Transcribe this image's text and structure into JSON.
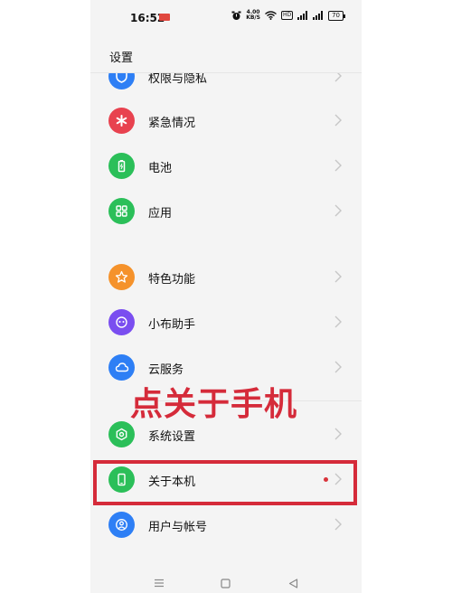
{
  "status_bar": {
    "time": "16:52",
    "notification_badge": "",
    "network_speed_top": "4.00",
    "network_speed_bottom": "KB/S",
    "hd_tag": "HD",
    "battery": "70",
    "icons": [
      "alarm-icon",
      "wifi-icon",
      "signal-icon",
      "signal-icon"
    ]
  },
  "header": {
    "title": "设置"
  },
  "settings_items": [
    {
      "label": "权限与隐私",
      "icon": "shield-icon",
      "color": "#2e7ff5"
    },
    {
      "label": "紧急情况",
      "icon": "asterisk-icon",
      "color": "#e8424f"
    },
    {
      "label": "电池",
      "icon": "battery-icon",
      "color": "#2bbf59"
    },
    {
      "label": "应用",
      "icon": "grid-icon",
      "color": "#2bbf59"
    },
    {
      "label": "特色功能",
      "icon": "star-icon",
      "color": "#f5922b"
    },
    {
      "label": "小布助手",
      "icon": "assistant-icon",
      "color": "#7a4ef0"
    },
    {
      "label": "云服务",
      "icon": "cloud-icon",
      "color": "#2e7ff5"
    },
    {
      "label": "系统设置",
      "icon": "gear-icon",
      "color": "#2bbf59"
    },
    {
      "label": "关于本机",
      "icon": "phone-icon",
      "color": "#2bbf59",
      "has_dot": true
    },
    {
      "label": "用户与帐号",
      "icon": "user-icon",
      "color": "#2e7ff5"
    }
  ],
  "annotation": {
    "overlay_text": "点关于手机",
    "color": "#d52b3a"
  },
  "navigation": {
    "icons": [
      "menu-icon",
      "home-icon",
      "back-icon"
    ]
  }
}
